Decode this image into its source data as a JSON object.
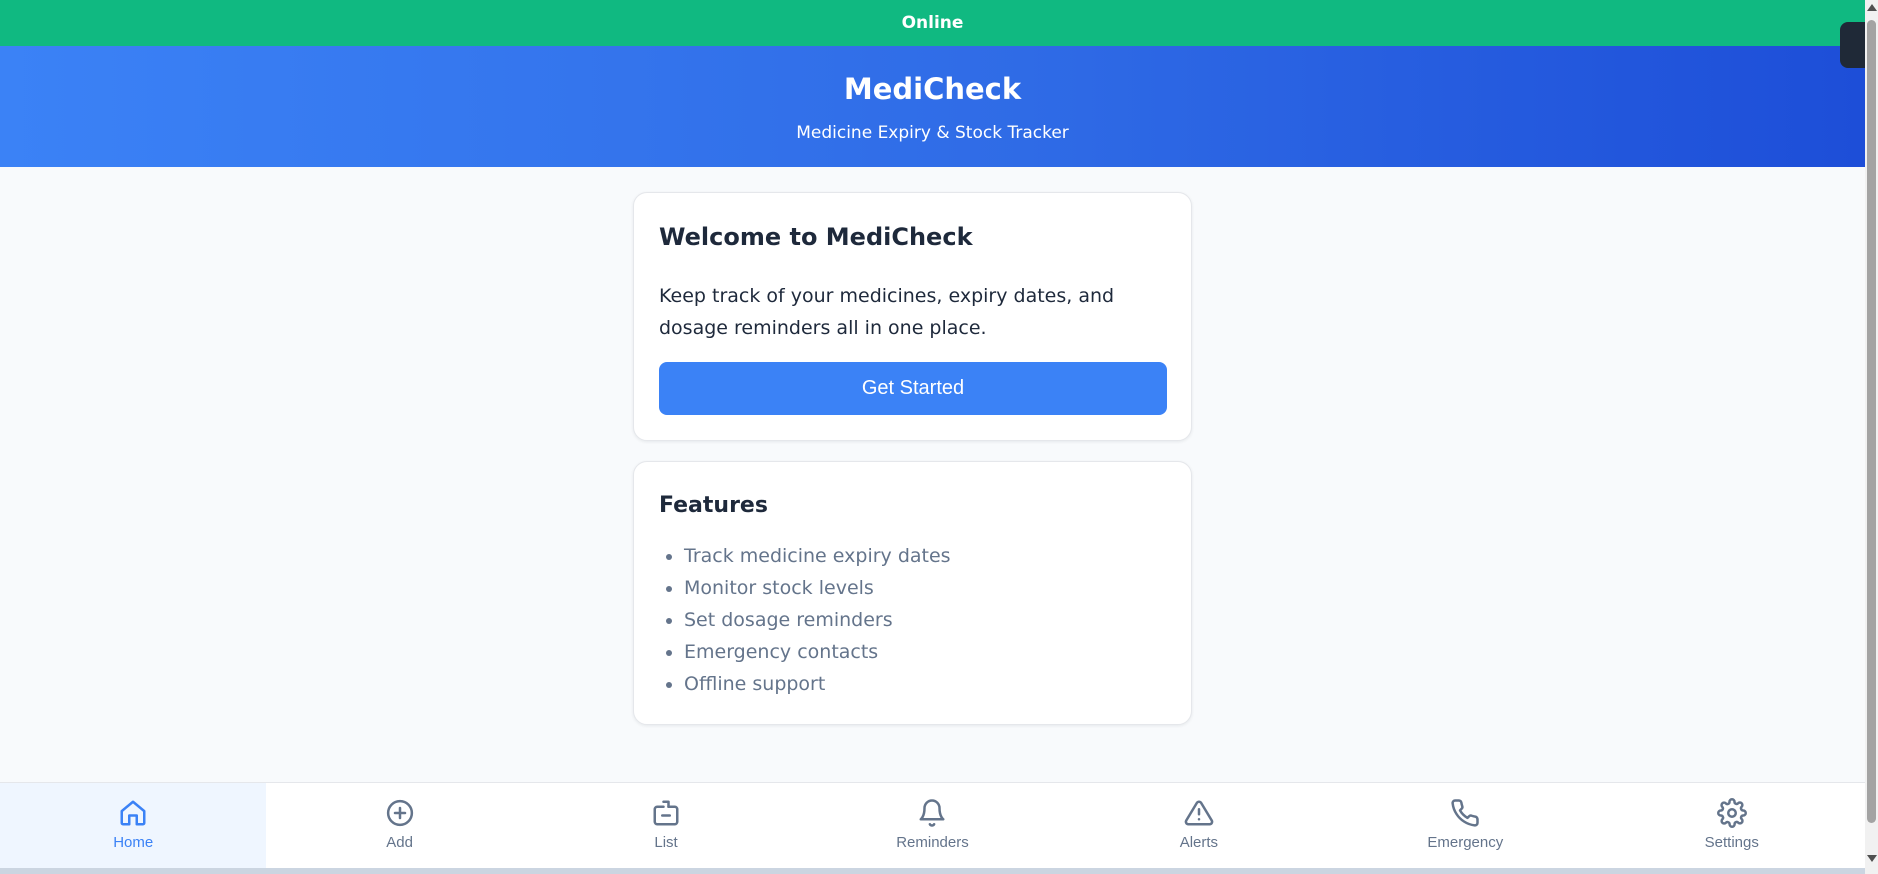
{
  "status": {
    "text": "Online",
    "color": "#10b981"
  },
  "header": {
    "title": "MediCheck",
    "subtitle": "Medicine Expiry & Stock Tracker"
  },
  "welcome": {
    "heading": "Welcome to MediCheck",
    "text": "Keep track of your medicines, expiry dates, and dosage reminders all in one place.",
    "button_label": "Get Started"
  },
  "features": {
    "heading": "Features",
    "items": [
      "Track medicine expiry dates",
      "Monitor stock levels",
      "Set dosage reminders",
      "Emergency contacts",
      "Offline support"
    ]
  },
  "nav": {
    "active": "Home",
    "items": [
      {
        "label": "Home",
        "icon": "home-icon"
      },
      {
        "label": "Add",
        "icon": "plus-circle-icon"
      },
      {
        "label": "List",
        "icon": "medicine-box-icon"
      },
      {
        "label": "Reminders",
        "icon": "bell-icon"
      },
      {
        "label": "Alerts",
        "icon": "warning-triangle-icon"
      },
      {
        "label": "Emergency",
        "icon": "phone-icon"
      },
      {
        "label": "Settings",
        "icon": "gear-icon"
      }
    ]
  },
  "colors": {
    "accent": "#3b82f6",
    "header_gradient_start": "#3b82f6",
    "header_gradient_end": "#1d4ed8",
    "muted_text": "#64748b"
  }
}
